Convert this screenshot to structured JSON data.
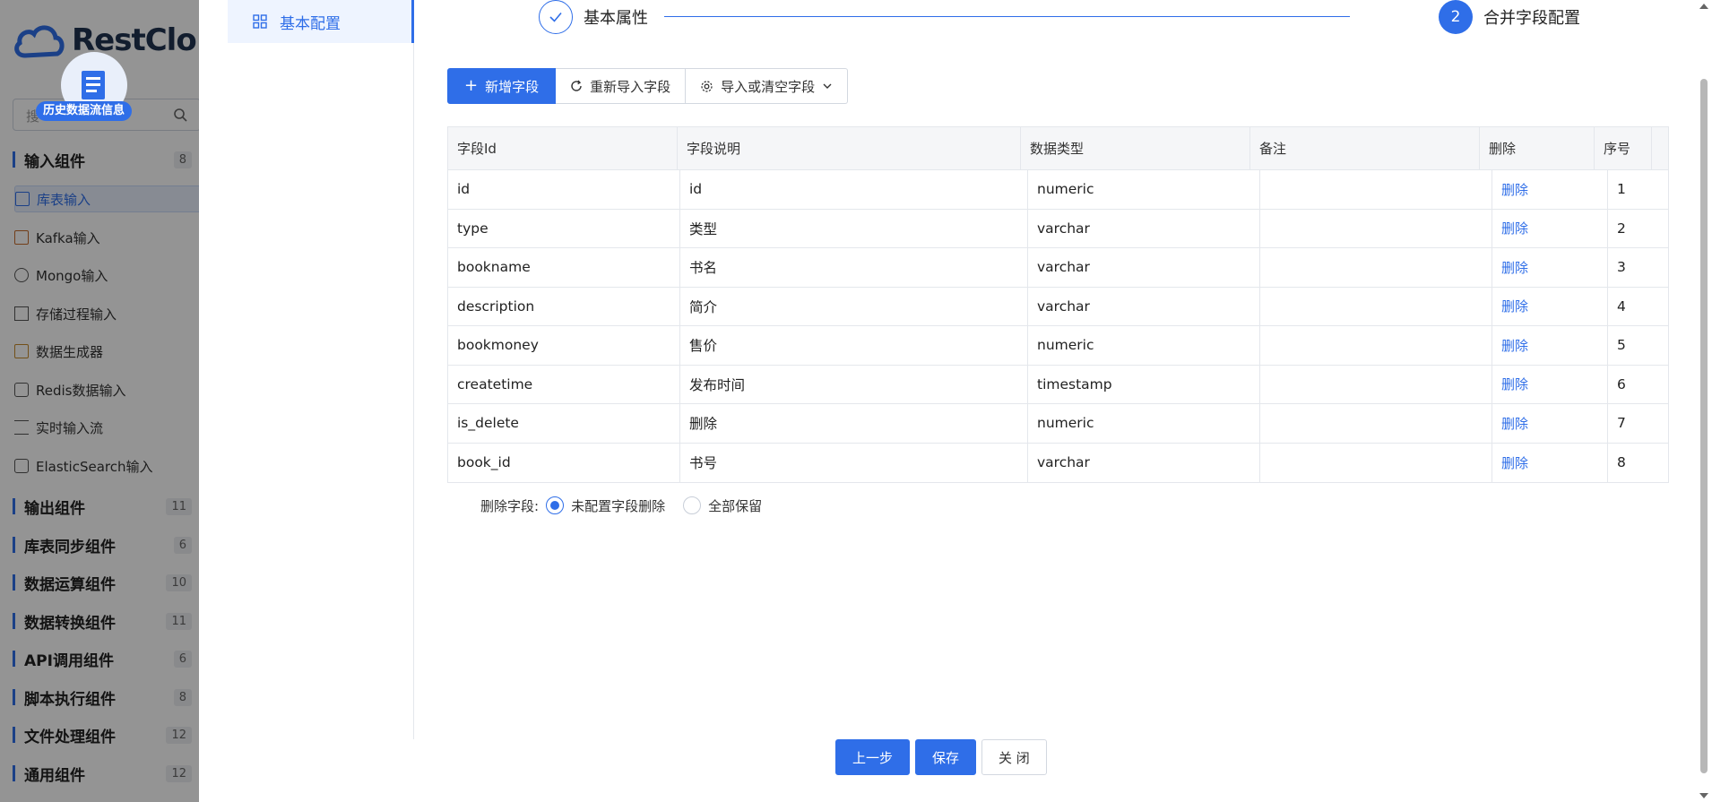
{
  "bg_sidebar": {
    "logo_text": "RestClo",
    "floating_badge": "历史数据流信息",
    "search_placeholder": "搜",
    "groups": [
      {
        "label": "输入组件",
        "count": "8"
      },
      {
        "label": "输出组件",
        "count": "11"
      },
      {
        "label": "库表同步组件",
        "count": "6"
      },
      {
        "label": "数据运算组件",
        "count": "10"
      },
      {
        "label": "数据转换组件",
        "count": "11"
      },
      {
        "label": "API调用组件",
        "count": "6"
      },
      {
        "label": "脚本执行组件",
        "count": "8"
      },
      {
        "label": "文件处理组件",
        "count": "12"
      },
      {
        "label": "通用组件",
        "count": "12"
      }
    ],
    "input_items": [
      {
        "label": "库表输入",
        "icon": "table-input-icon"
      },
      {
        "label": "Kafka输入",
        "icon": "kafka-icon"
      },
      {
        "label": "Mongo输入",
        "icon": "mongo-icon"
      },
      {
        "label": "存储过程输入",
        "icon": "procedure-icon"
      },
      {
        "label": "数据生成器",
        "icon": "generator-icon"
      },
      {
        "label": "Redis数据输入",
        "icon": "redis-icon"
      },
      {
        "label": "实时输入流",
        "icon": "stream-icon"
      },
      {
        "label": "ElasticSearch输入",
        "icon": "elasticsearch-icon"
      }
    ]
  },
  "drawer": {
    "nav": [
      {
        "label": "基本配置",
        "icon": "grid-icon"
      }
    ],
    "steps": [
      {
        "label": "基本属性",
        "status": "done",
        "marker": "✓"
      },
      {
        "label": "合并字段配置",
        "status": "current",
        "marker": "2"
      }
    ],
    "toolbar": {
      "add_label": "新增字段",
      "reimport_label": "重新导入字段",
      "import_clear_label": "导入或清空字段"
    },
    "table": {
      "columns": [
        "字段Id",
        "字段说明",
        "数据类型",
        "备注",
        "删除",
        "序号"
      ],
      "rows": [
        {
          "id": "id",
          "desc": "id",
          "type": "numeric",
          "note": "",
          "action": "删除",
          "seq": "1"
        },
        {
          "id": "type",
          "desc": "类型",
          "type": "varchar",
          "note": "",
          "action": "删除",
          "seq": "2"
        },
        {
          "id": "bookname",
          "desc": "书名",
          "type": "varchar",
          "note": "",
          "action": "删除",
          "seq": "3"
        },
        {
          "id": "description",
          "desc": "简介",
          "type": "varchar",
          "note": "",
          "action": "删除",
          "seq": "4"
        },
        {
          "id": "bookmoney",
          "desc": "售价",
          "type": "numeric",
          "note": "",
          "action": "删除",
          "seq": "5"
        },
        {
          "id": "createtime",
          "desc": "发布时间",
          "type": "timestamp",
          "note": "",
          "action": "删除",
          "seq": "6"
        },
        {
          "id": "is_delete",
          "desc": "删除",
          "type": "numeric",
          "note": "",
          "action": "删除",
          "seq": "7"
        },
        {
          "id": "book_id",
          "desc": "书号",
          "type": "varchar",
          "note": "",
          "action": "删除",
          "seq": "8"
        }
      ]
    },
    "delete_fields": {
      "label": "删除字段:",
      "options": [
        {
          "label": "未配置字段删除",
          "selected": true
        },
        {
          "label": "全部保留",
          "selected": false
        }
      ]
    },
    "buttons": {
      "prev": "上一步",
      "save": "保存",
      "close": "关 闭"
    }
  },
  "colors": {
    "accent": "#2f6ee8",
    "overlay": "rgba(0,0,0,0.42)"
  }
}
